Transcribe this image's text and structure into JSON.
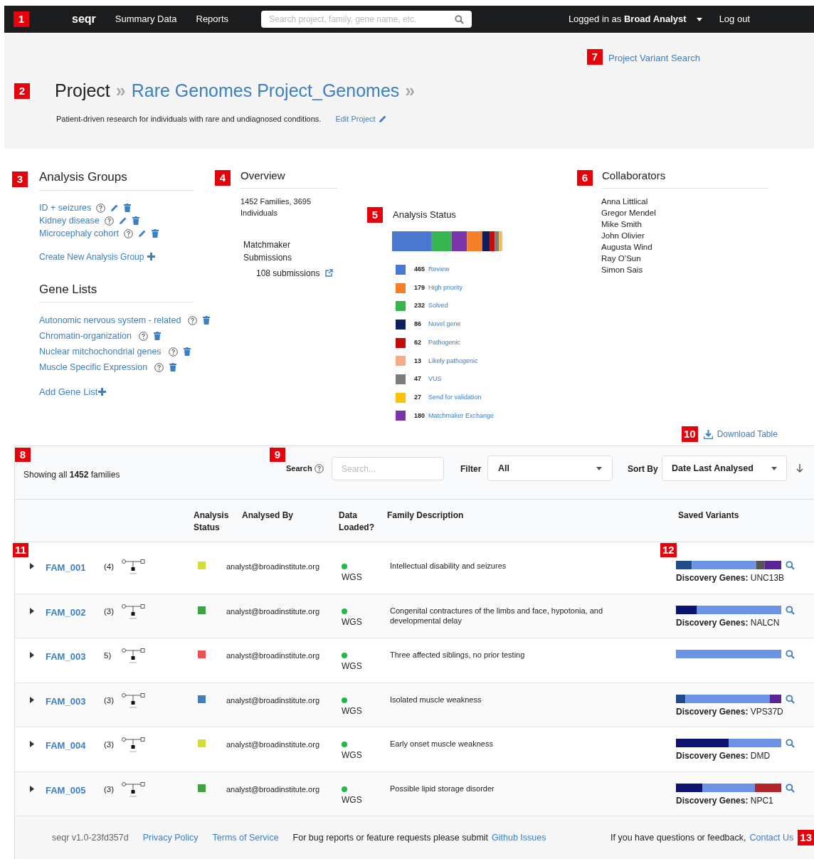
{
  "top_bar": {
    "marker": "1",
    "logo": "seqr",
    "nav": [
      "Summary Data",
      "Reports"
    ],
    "search": {
      "placeholder": "Search project, family, gene name, etc."
    },
    "user_prefix": "Logged in as",
    "user_name": "Broad Analyst",
    "logout": "Log out"
  },
  "project_header": {
    "marker": "2",
    "label": "Project",
    "separator": "»",
    "project_name": "Rare Genomes Project_Genomes",
    "trailing_separator": "»",
    "description": "Patient-driven research for individuals with rare and undiagnosed conditions.",
    "edit_link": "Edit Project",
    "variant_search": {
      "marker": "7",
      "label": "Project Variant Search"
    }
  },
  "analysis_groups": {
    "marker": "3",
    "title": "Analysis Groups",
    "items": [
      "ID + seizures",
      "Kidney disease",
      "Microcephaly cohort"
    ],
    "create_link": "Create New Analysis Group"
  },
  "gene_lists": {
    "title": "Gene Lists",
    "items": [
      "Autonomic nervous system - related",
      "Chromatin-organization",
      "Nuclear mitchochondrial genes",
      "Muscle Specific Expression"
    ],
    "add_link": "Add Gene List"
  },
  "overview": {
    "marker": "4",
    "title": "Overview",
    "summary": "1452 Families, 3695 Individuals",
    "matchmaker_title": "Matchmaker Submissions",
    "submissions": "108 submissions"
  },
  "analysis_status": {
    "marker": "5",
    "title": "Analysis Status",
    "legend": [
      {
        "count": "465",
        "label": "Review",
        "color": "#4a78d0"
      },
      {
        "count": "179",
        "label": "High priority",
        "color": "#f57f29"
      },
      {
        "count": "232",
        "label": "Solved",
        "color": "#36b44f"
      },
      {
        "count": "86",
        "label": "Novel gene",
        "color": "#0e1d5e"
      },
      {
        "count": "62",
        "label": "Pathogenic",
        "color": "#c20c0c"
      },
      {
        "count": "13",
        "label": "Likely pathogenic",
        "color": "#f3ad88"
      },
      {
        "count": "47",
        "label": "VUS",
        "color": "#7d7d7d"
      },
      {
        "count": "27",
        "label": "Send for validation",
        "color": "#ffc107"
      },
      {
        "count": "180",
        "label": "Matchmaker Exchange",
        "color": "#7a35ad"
      }
    ]
  },
  "collaborators": {
    "marker": "6",
    "title": "Collaborators",
    "names": [
      "Anna Littlical",
      "Gregor Mendel",
      "Mike Smith",
      "John Olivier",
      "Augusta Wind",
      "Ray O’Sun",
      "Simon Sais"
    ]
  },
  "download": {
    "marker": "10",
    "label": "Download Table"
  },
  "families_table": {
    "marker": "8",
    "showing_prefix": "Showing all",
    "showing_count": "1452",
    "showing_suffix": "families",
    "search": {
      "marker": "9",
      "label": "Search",
      "placeholder": "Search..."
    },
    "filter": {
      "label": "Filter",
      "value": "All"
    },
    "sort": {
      "label": "Sort By",
      "value": "Date Last Analysed"
    },
    "columns": [
      "Analysis Status",
      "Analysed By",
      "Data Loaded?",
      "Family Description",
      "Saved Variants"
    ],
    "rows_marker": "11",
    "saved_marker": "12",
    "rows": [
      {
        "name": "FAM_001",
        "count": "(4)",
        "color": "#d4dd3a",
        "analysed_by": "analyst@broadinstitute.org",
        "data": "WGS",
        "description": "Intellectual disability and seizures",
        "genes_label": "Discovery Genes:",
        "genes": "UNC13B"
      },
      {
        "name": "FAM_002",
        "count": "(3)",
        "color": "#3fa345",
        "analysed_by": "analyst@broadinstitute.org",
        "data": "WGS",
        "description": "Congenital contractures of the limbs and face, hypotonia, and developmental delay",
        "genes_label": "Discovery Genes:",
        "genes": "NALCN"
      },
      {
        "name": "FAM_003",
        "count": "5)",
        "color": "#ec5252",
        "analysed_by": "analyst@broadinstitute.org",
        "data": "WGS",
        "description": "Three affected siblings, no prior testing"
      },
      {
        "name": "FAM_003",
        "count": "(3)",
        "color": "#3f7fbf",
        "analysed_by": "analyst@broadinstitute.org",
        "data": "WGS",
        "description": "Isolated muscle weakness",
        "genes_label": "Discovery Genes:",
        "genes": "VPS37D"
      },
      {
        "name": "FAM_004",
        "count": "(3)",
        "color": "#d4dd3a",
        "analysed_by": "analyst@broadinstitute.org",
        "data": "WGS",
        "description": "Early onset muscle weakness",
        "genes_label": "Discovery Genes:",
        "genes": "DMD"
      },
      {
        "name": "FAM_005",
        "count": "(3)",
        "color": "#3fa345",
        "analysed_by": "analyst@broadinstitute.org",
        "data": "WGS",
        "description": "Possible lipid storage disorder",
        "genes_label": "Discovery Genes:",
        "genes": "NPC1"
      }
    ]
  },
  "footer": {
    "marker": "13",
    "version": "seqr v1.0-23fd357d",
    "links": [
      "Privacy Policy",
      "Terms of Service"
    ],
    "bug_text": "For bug reports or feature requests please submit",
    "bug_link": "Github Issues",
    "contact_text": "If you have questions or feedback,",
    "contact_link": "Contact Us"
  }
}
